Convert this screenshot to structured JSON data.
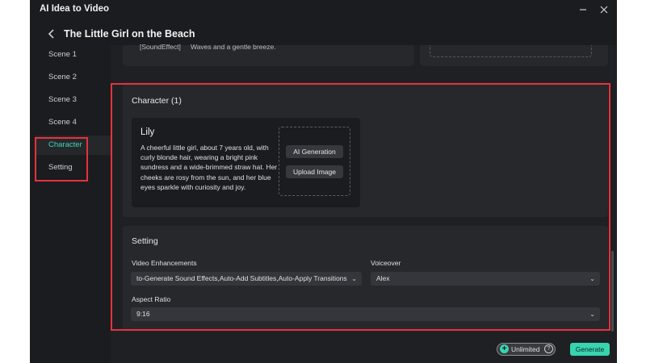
{
  "window": {
    "title": "AI Idea to Video"
  },
  "header": {
    "title": "The Little Girl on the Beach"
  },
  "sidebar": {
    "items": [
      {
        "label": "Scene 1"
      },
      {
        "label": "Scene 2"
      },
      {
        "label": "Scene 3"
      },
      {
        "label": "Scene 4"
      },
      {
        "label": "Character"
      },
      {
        "label": "Setting"
      }
    ]
  },
  "scene_partial": {
    "sound_effect_key": "[SoundEffect]",
    "sound_effect_value": "Waves and a gentle breeze."
  },
  "character_section": {
    "title": "Character (1)",
    "character": {
      "name": "Lily",
      "description": "A cheerful little girl, about 7 years old, with curly blonde hair, wearing a bright pink sundress and a wide-brimmed straw hat. Her cheeks are rosy from the sun, and her blue eyes sparkle with curiosity and joy.",
      "ai_generation_label": "AI Generation",
      "upload_image_label": "Upload Image"
    }
  },
  "setting_section": {
    "title": "Setting",
    "video_enhancements": {
      "label": "Video Enhancements",
      "value": "to-Generate Sound Effects,Auto-Add Subtitles,Auto-Apply Transitions"
    },
    "voiceover": {
      "label": "Voiceover",
      "value": "Alex"
    },
    "aspect_ratio": {
      "label": "Aspect Ratio",
      "value": "9:16"
    }
  },
  "footer": {
    "unlimited_label": "Unlimited",
    "generate_label": "Generate"
  },
  "colors": {
    "accent": "#37d4b0",
    "highlight": "#e6323c",
    "window_bg": "#1b1c1f"
  }
}
